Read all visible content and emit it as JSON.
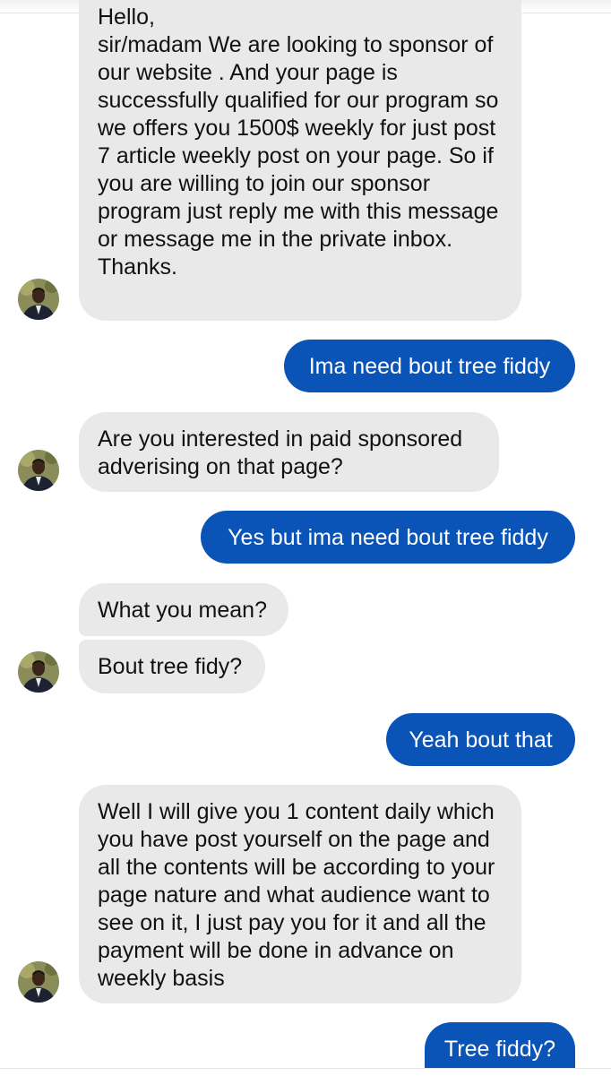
{
  "conversation": {
    "messages": [
      {
        "id": 1,
        "direction": "incoming",
        "text": "Hello,\nsir/madam We are looking to sponsor of our website . And your page is successfully qualified for our program so we offers you 1500$ weekly for just post 7 article weekly post on your page. So if you are willing to join our sponsor program just reply me with this message or message me in the private inbox.\nThanks."
      },
      {
        "id": 2,
        "direction": "outgoing",
        "text": "Ima need bout tree fiddy"
      },
      {
        "id": 3,
        "direction": "incoming",
        "text": "Are you interested in paid sponsored adverising on that page?"
      },
      {
        "id": 4,
        "direction": "outgoing",
        "text": "Yes but ima need bout tree fiddy"
      },
      {
        "id": 5,
        "direction": "incoming",
        "text": "What you mean?"
      },
      {
        "id": 6,
        "direction": "incoming",
        "text": "Bout tree fidy?"
      },
      {
        "id": 7,
        "direction": "outgoing",
        "text": "Yeah bout that"
      },
      {
        "id": 8,
        "direction": "incoming",
        "text": "Well I will give you 1 content daily which you have post yourself on the page and all the contents will be according to your page nature and what audience want to see on it, I just pay you for it and all the payment will be done in advance on weekly basis"
      },
      {
        "id": 9,
        "direction": "outgoing",
        "text": "Tree fiddy?"
      }
    ]
  },
  "colors": {
    "incoming_bubble": "#e9e9e9",
    "outgoing_bubble": "#0a54b7",
    "outgoing_text": "#ffffff",
    "incoming_text": "#111111"
  },
  "icons": {
    "avatar": "contact-avatar-icon"
  }
}
